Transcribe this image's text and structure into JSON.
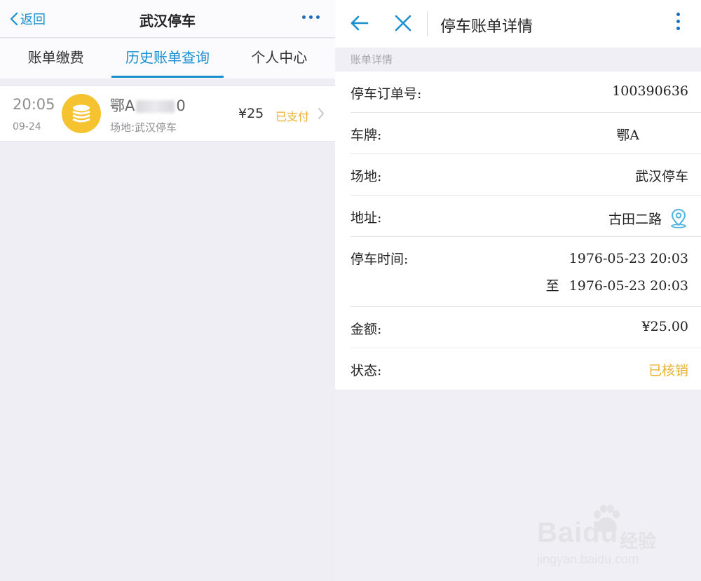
{
  "left": {
    "header": {
      "back_label": "返回",
      "title": "武汉停车"
    },
    "tabs": [
      {
        "label": "账单缴费",
        "active": false
      },
      {
        "label": "历史账单查询",
        "active": true
      },
      {
        "label": "个人中心",
        "active": false
      }
    ],
    "bills": [
      {
        "time": "20:05",
        "date": "09-24",
        "plate_prefix": "鄂A",
        "plate_suffix": "0",
        "site": "场地:武汉停车",
        "amount": "¥25",
        "status": "已支付"
      }
    ]
  },
  "right": {
    "header": {
      "title": "停车账单详情"
    },
    "section_label": "账单详情",
    "rows": {
      "order_no": {
        "label": "停车订单号:",
        "value": "100390636"
      },
      "plate": {
        "label": "车牌:",
        "value": "鄂A"
      },
      "site": {
        "label": "场地:",
        "value": "武汉停车"
      },
      "address": {
        "label": "地址:",
        "value": "古田二路"
      },
      "time": {
        "label": "停车时间:",
        "start": "1976-05-23 20:03",
        "to": "至",
        "end": "1976-05-23 20:03"
      },
      "amount": {
        "label": "金额:",
        "value": "¥25.00"
      },
      "status": {
        "label": "状态:",
        "value": "已核销"
      }
    }
  },
  "watermark": {
    "brand": "Baidu",
    "cn": "经验",
    "url": "jingyan.baidu.com"
  },
  "colors": {
    "accent": "#1a8fd0",
    "status_yellow": "#e9b22c",
    "coin": "#f6c330"
  }
}
